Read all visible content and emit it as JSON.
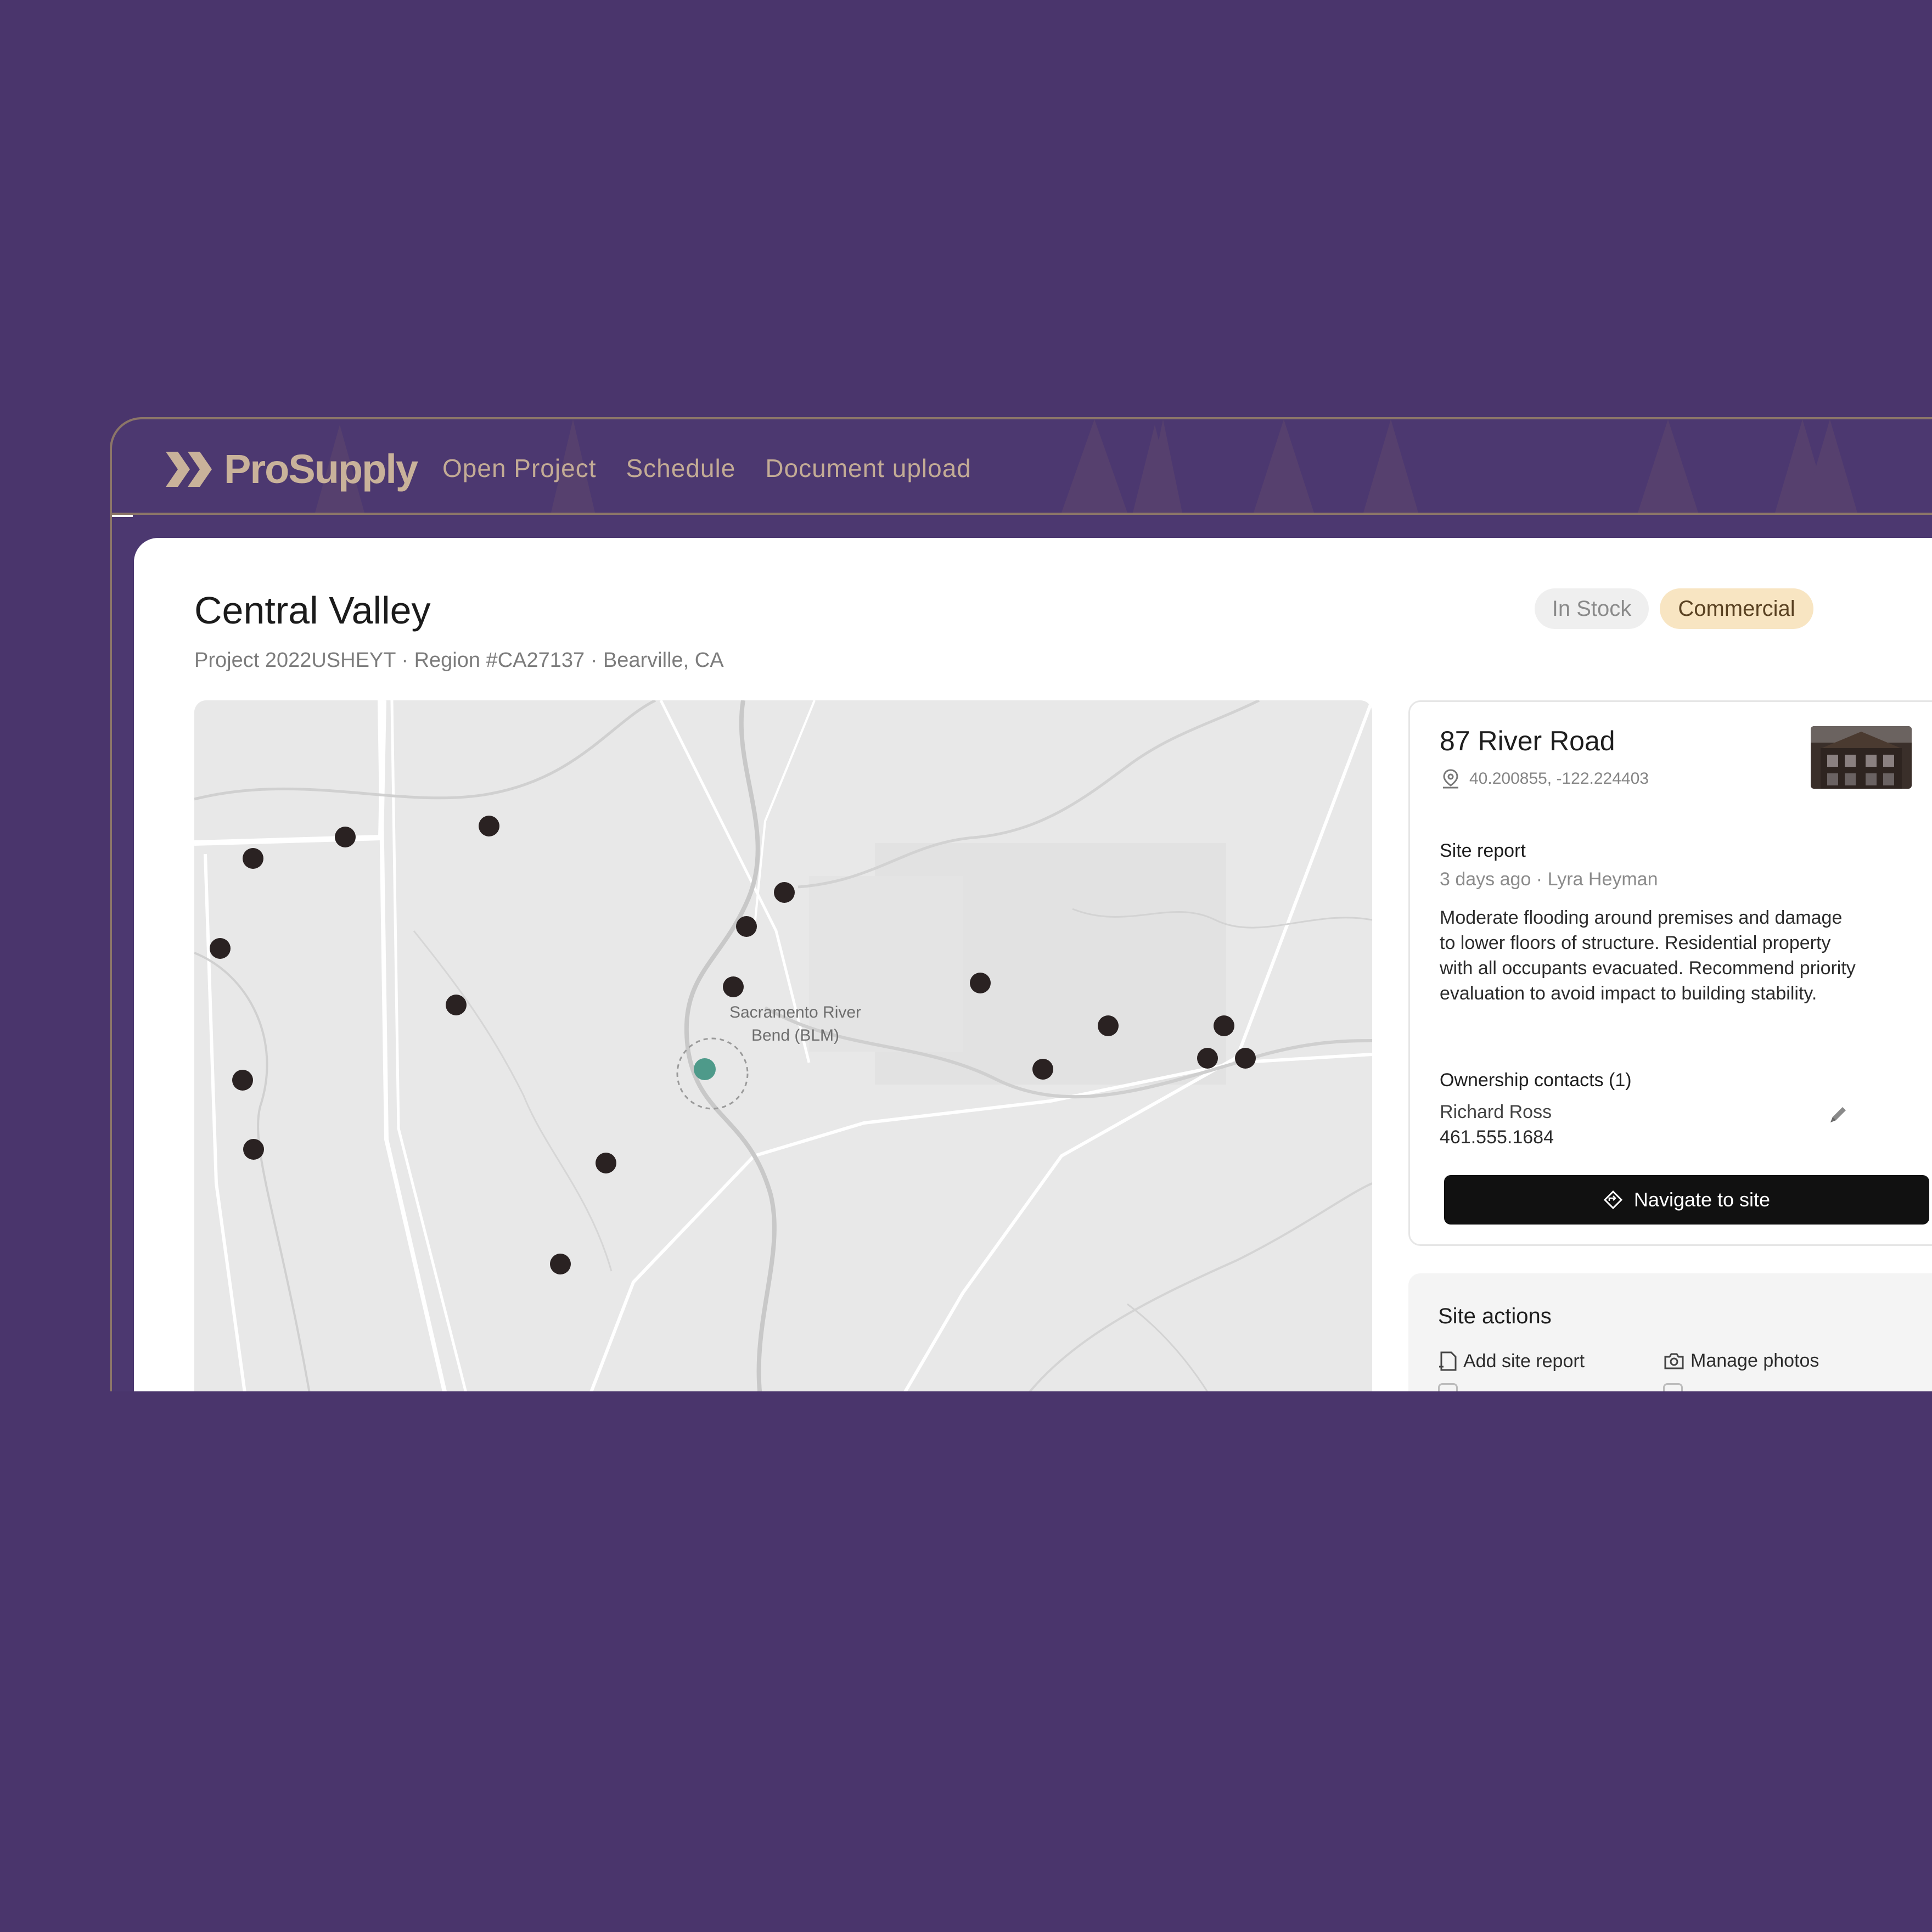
{
  "brand": {
    "name": "ProSupply"
  },
  "nav": {
    "links": [
      "Open Project",
      "Schedule",
      "Document upload"
    ]
  },
  "project": {
    "title": "Central Valley",
    "subtitle": "Project 2022USHEYT · Region #CA27137 · Bearville, CA",
    "status_badge": "In Stock",
    "type_badge": "Commercial"
  },
  "map": {
    "place_label": "Sacramento River\nBend (BLM)"
  },
  "site": {
    "title": "87 River Road",
    "coordinates": "40.200855, -122.224403",
    "report_label": "Site report",
    "report_meta": "3 days ago · Lyra Heyman",
    "report_text": "Moderate flooding around premises and damage to lower floors of structure. Residential property with all occupants evacuated. Recommend priority evaluation to avoid impact to building stability.",
    "contacts_label": "Ownership contacts (1)",
    "contact_name": "Richard Ross",
    "contact_phone": "461.555.1684",
    "navigate_label": "Navigate to site"
  },
  "actions": {
    "title": "Site actions",
    "items": [
      "Add site report",
      "Manage photos"
    ]
  },
  "colors": {
    "background": "#4a356c",
    "accent": "#c9b29a",
    "selected_marker": "#4e9a8a",
    "marker": "#2a2222"
  }
}
